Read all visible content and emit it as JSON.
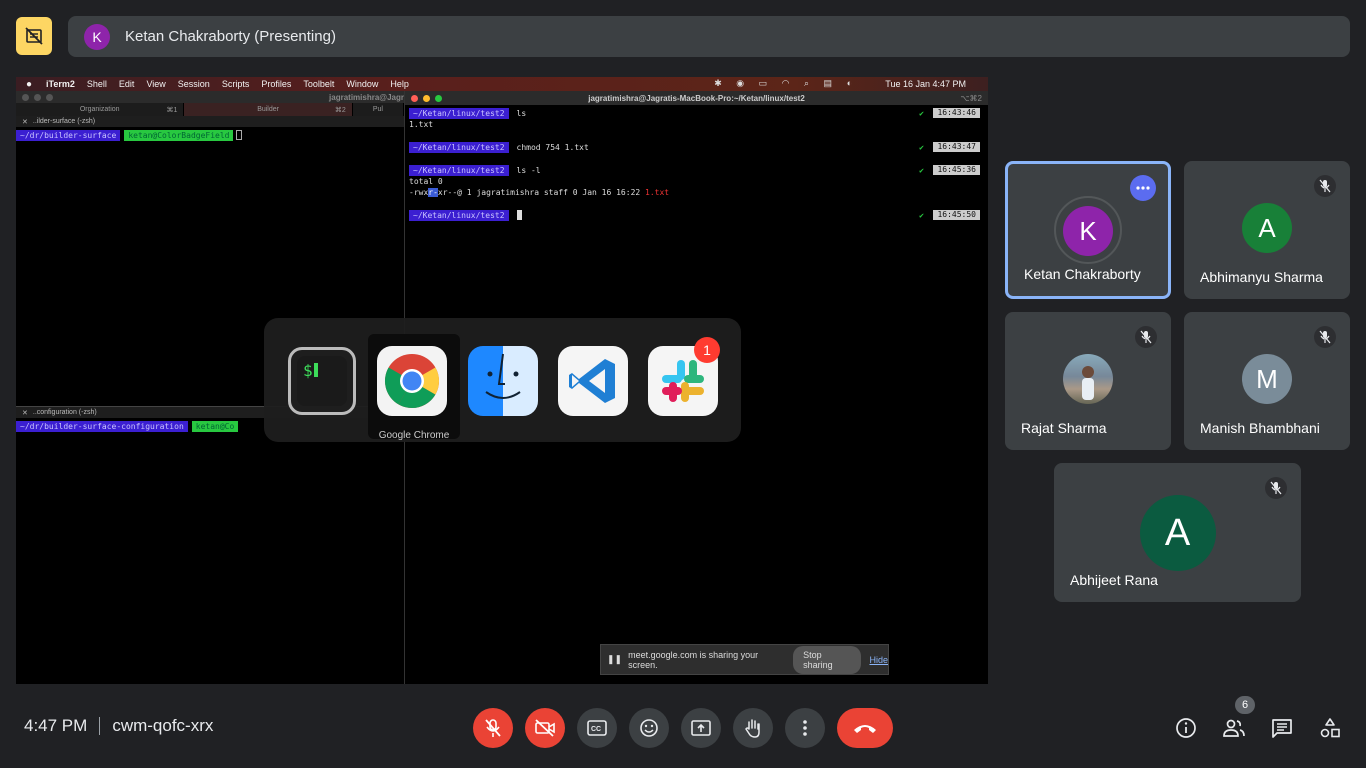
{
  "presenter": {
    "initial": "K",
    "label": "Ketan Chakraborty (Presenting)"
  },
  "mac_menubar": {
    "items": [
      "iTerm2",
      "Shell",
      "Edit",
      "View",
      "Session",
      "Scripts",
      "Profiles",
      "Toolbelt",
      "Window",
      "Help"
    ],
    "clock": "Tue 16 Jan  4:47 PM"
  },
  "left_terminal": {
    "title": "jagratimishra@Jagr",
    "tabs": [
      {
        "label": "Organization",
        "shortcut": "⌘1"
      },
      {
        "label": "Builder",
        "shortcut": "⌘2"
      },
      {
        "label": "Pul"
      }
    ],
    "pane1_title": "..ilder-surface (-zsh)",
    "pane1_path": "~/dr/builder-surface",
    "pane1_branch": "ketan@ColorBadgeField",
    "pane2_title": "..configuration (-zsh)",
    "pane2_path": "~/dr/builder-surface-configuration",
    "pane2_branch": "ketan@Co"
  },
  "right_terminal": {
    "title": "jagratimishra@Jagratis-MacBook-Pro:~/Ketan/linux/test2",
    "shortcut": "⌥⌘2",
    "prompt": "~/Ketan/linux/test2",
    "commands": [
      {
        "cmd": "ls",
        "time": "16:43:46",
        "output": [
          "1.txt"
        ]
      },
      {
        "cmd": "chmod 754 1.txt",
        "time": "16:43:47",
        "output": []
      },
      {
        "cmd": "ls -l",
        "time": "16:45:36",
        "output": [
          "total 0"
        ]
      }
    ],
    "ls_line": {
      "pre": "-rwx",
      "hl": "r-",
      "post": "xr--@ 1 jagratimishra  staff  0 Jan 16 16:22 ",
      "file": "1.txt"
    },
    "last_time": "16:45:50"
  },
  "app_switcher": {
    "apps": [
      "terminal-icon",
      "chrome-icon",
      "finder-icon",
      "vscode-icon",
      "slack-icon"
    ],
    "selected_label": "Google Chrome",
    "slack_badge": "1"
  },
  "share_notice": {
    "text": "meet.google.com is sharing your screen.",
    "stop": "Stop sharing",
    "hide": "Hide"
  },
  "participants": [
    {
      "name": "Ketan Chakraborty",
      "initial": "K",
      "color": "#8e24aa"
    },
    {
      "name": "Abhimanyu Sharma",
      "initial": "A",
      "color": "#188038"
    },
    {
      "name": "Rajat Sharma",
      "initial": ""
    },
    {
      "name": "Manish Bhambhani",
      "initial": "M",
      "color": "#7a8c99"
    },
    {
      "name": "Abhijeet Rana",
      "initial": "A",
      "color": "#0b5b40"
    }
  ],
  "meeting": {
    "time": "4:47 PM",
    "code": "cwm-qofc-xrx",
    "people_count": "6"
  },
  "colors": {
    "accent": "#8ab4f8",
    "danger": "#ea4335",
    "background": "#202124",
    "tile": "#3c4043"
  }
}
